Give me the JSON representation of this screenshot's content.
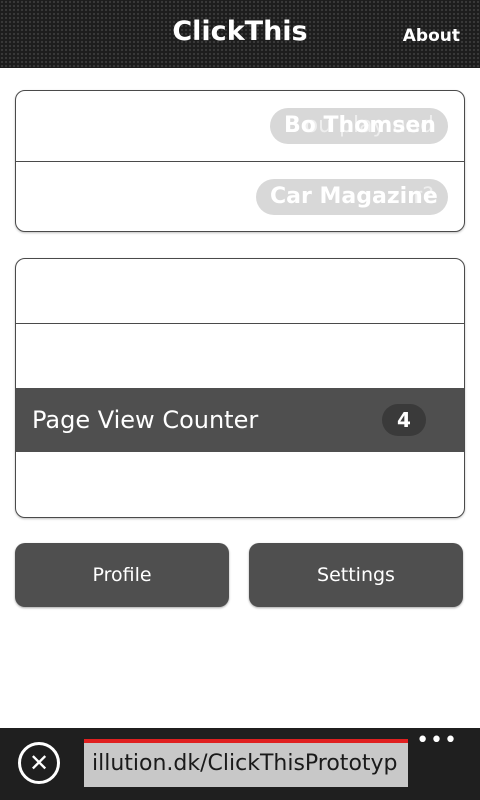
{
  "header": {
    "title": "ClickThis",
    "about": "About"
  },
  "list1": {
    "items": [
      {
        "label": "Bo Thomsen",
        "ghost": "ou play and"
      },
      {
        "label": "Car Magazine",
        "ghost": "r?"
      }
    ]
  },
  "list2": {
    "counter_label": "Page View Counter",
    "counter_value": "4"
  },
  "buttons": {
    "profile": "Profile",
    "settings": "Settings"
  },
  "browser": {
    "url": "illution.dk/ClickThisPrototyp",
    "more": "•••",
    "close": "✕"
  },
  "colors": {
    "accent": "#e02020",
    "dark": "#4f4f4f"
  }
}
